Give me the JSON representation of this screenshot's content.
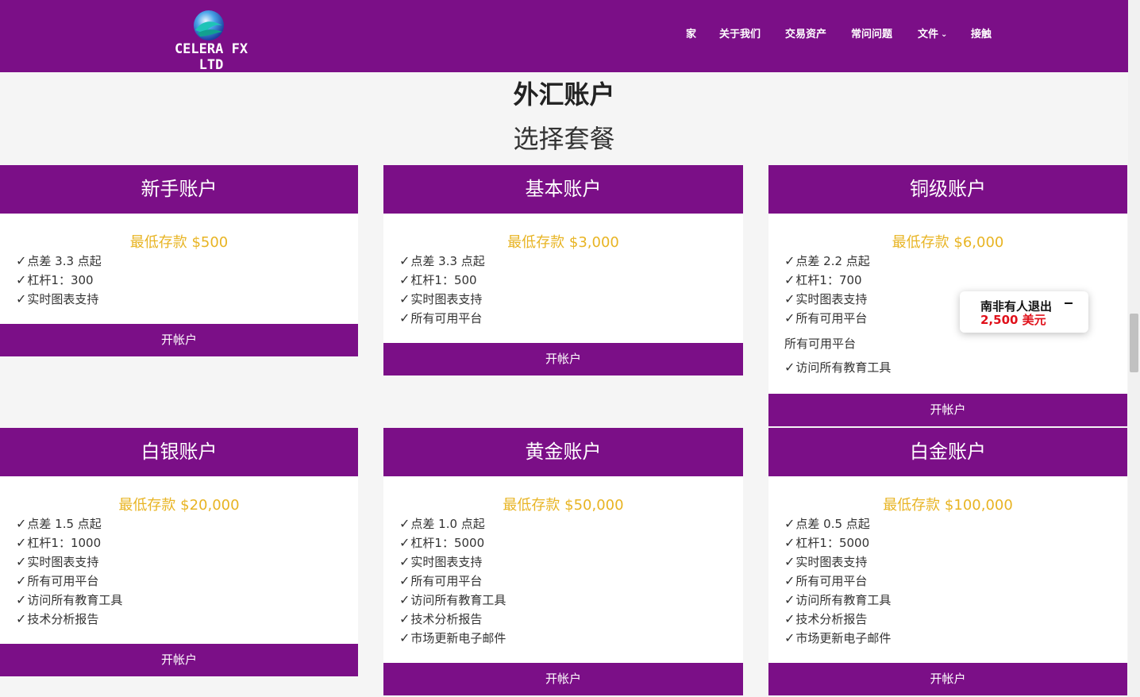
{
  "header": {
    "logo_text": "CELERA FX LTD",
    "nav": [
      {
        "label": "家",
        "has_dropdown": false
      },
      {
        "label": "关于我们",
        "has_dropdown": false
      },
      {
        "label": "交易资产",
        "has_dropdown": false
      },
      {
        "label": "常问问题",
        "has_dropdown": false
      },
      {
        "label": "文件",
        "has_dropdown": true
      },
      {
        "label": "接触",
        "has_dropdown": false
      }
    ]
  },
  "main": {
    "title": "外汇账户",
    "subtitle": "选择套餐"
  },
  "cards": [
    {
      "name": "新手账户",
      "price": "最低存款 $500",
      "features": [
        "点差 3.3 点起",
        "杠杆1：300",
        "实时图表支持"
      ],
      "button": "开帐户"
    },
    {
      "name": "基本账户",
      "price": "最低存款 $3,000",
      "features": [
        "点差 3.3 点起",
        "杠杆1：500",
        "实时图表支持",
        "所有可用平台"
      ],
      "button": "开帐户"
    },
    {
      "name": "铜级账户",
      "price": "最低存款 $6,000",
      "features": [
        "点差 2.2 点起",
        "杠杆1：700",
        "实时图表支持",
        "所有可用平台"
      ],
      "plain_line": "所有可用平台",
      "extra_feature": "访问所有教育工具",
      "button": "开帐户"
    },
    {
      "name": "白银账户",
      "price": "最低存款 $20,000",
      "features": [
        "点差 1.5 点起",
        "杠杆1：1000",
        "实时图表支持",
        "所有可用平台",
        "访问所有教育工具",
        "技术分析报告"
      ],
      "button": "开帐户"
    },
    {
      "name": "黄金账户",
      "price": "最低存款 $50,000",
      "features": [
        "点差 1.0 点起",
        "杠杆1：5000",
        "实时图表支持",
        "所有可用平台",
        "访问所有教育工具",
        "技术分析报告",
        "市场更新电子邮件"
      ],
      "button": "开帐户"
    },
    {
      "name": "白金账户",
      "price": "最低存款 $100,000",
      "features": [
        "点差 0.5 点起",
        "杠杆1：5000",
        "实时图表支持",
        "所有可用平台",
        "访问所有教育工具",
        "技术分析报告",
        "市场更新电子邮件"
      ],
      "button": "开帐户"
    }
  ],
  "toast": {
    "line1": "南非有人退出",
    "line2": "2,500 美元"
  },
  "icons": {
    "check": "check-icon",
    "nav_dropdown": "chevron-down-icon",
    "logo": "wave-globe-icon"
  },
  "colors": {
    "brand_purple": "#7b0f87",
    "price_gold": "#e8b423",
    "toast_red": "#e0101a"
  }
}
